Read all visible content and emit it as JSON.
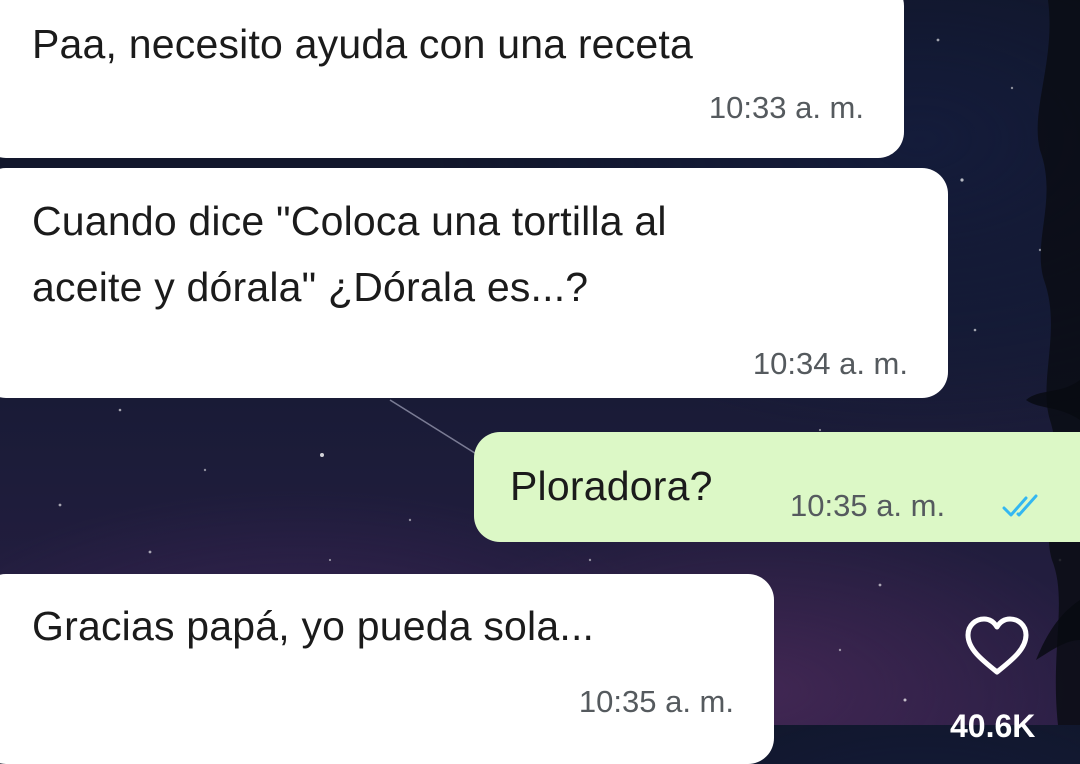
{
  "messages": [
    {
      "direction": "incoming",
      "text": "Paa, necesito ayuda con una receta",
      "time": "10:33 a. m."
    },
    {
      "direction": "incoming",
      "text_line1": "Cuando dice \"Coloca una tortilla al",
      "text_line2": "aceite y dórala\" ¿Dórala es...?",
      "time": "10:34 a. m."
    },
    {
      "direction": "outgoing",
      "text": "Ploradora?",
      "time": "10:35 a. m.",
      "status": "read-double-check-icon"
    },
    {
      "direction": "incoming",
      "text": "Gracias papá, yo pueda sola...",
      "time": "10:35 a. m."
    }
  ],
  "overlay": {
    "like_icon": "heart-outline-icon",
    "like_count": "40.6K"
  },
  "colors": {
    "incoming_bubble": "#ffffff",
    "outgoing_bubble": "#dcf8c6",
    "read_ticks": "#34b7f1"
  }
}
